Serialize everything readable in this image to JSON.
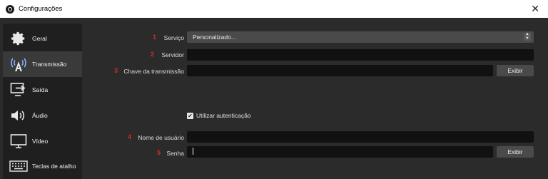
{
  "window": {
    "title": "Configurações",
    "close_symbol": "✕"
  },
  "sidebar": {
    "items": [
      {
        "label": "Geral",
        "icon": "gear-icon"
      },
      {
        "label": "Transmissão",
        "icon": "antenna-icon",
        "active": true
      },
      {
        "label": "Saída",
        "icon": "output-icon"
      },
      {
        "label": "Áudio",
        "icon": "speaker-icon"
      },
      {
        "label": "Vídeo",
        "icon": "monitor-icon"
      },
      {
        "label": "Teclas de atalho",
        "icon": "keyboard-icon"
      }
    ]
  },
  "form": {
    "servico": {
      "number": "1",
      "label": "Serviço",
      "value": "Personalizado..."
    },
    "servidor": {
      "number": "2",
      "label": "Servidor",
      "value": ""
    },
    "chave": {
      "number": "3",
      "label": "Chave da transmissão",
      "value": "",
      "button": "Exibir"
    },
    "auth": {
      "label": "Utilizar autenticação",
      "checked": true
    },
    "usuario": {
      "number": "4",
      "label": "Nome de usuário",
      "value": ""
    },
    "senha": {
      "number": "5",
      "label": "Senha",
      "value": "",
      "button": "Exibir"
    }
  },
  "colors": {
    "accent_number": "#d52b2b",
    "background": "#2b2b2b",
    "sidebar": "#1f1f1f",
    "field": "#111111"
  }
}
